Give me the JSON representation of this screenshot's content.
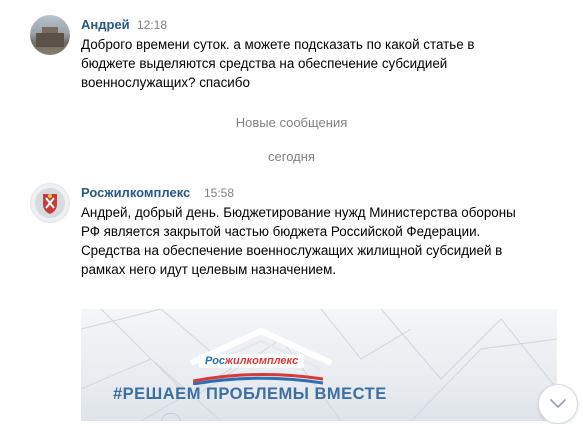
{
  "messages": [
    {
      "author": "Андрей",
      "time": "12:18",
      "text": "Доброго времени суток. а можете подсказать по какой статье в бюджете выделяются средства на обеспечение субсидией военнослужащих? спасибо"
    },
    {
      "author": "Росжилкомплекс",
      "time": "15:58",
      "text": "Андрей, добрый день. Бюджетирование нужд Министерства обороны РФ является закрытой частью бюджета Российской Федерации. Средства на обеспечение военнослужащих жилищной субсидией в рамках него идут целевым назначением."
    }
  ],
  "separators": {
    "new_messages": "Новые сообщения",
    "today": "сегодня"
  },
  "attachment": {
    "logo_part1": "Рос",
    "logo_part2": "жилкомплекс",
    "slogan": "#РЕШАЕМ ПРОБЛЕМЫ ВМЕСТЕ"
  },
  "icons": {
    "scroll_down": "chevron-down-icon"
  },
  "colors": {
    "author": "#2a5885",
    "meta": "#828282",
    "slogan": "#3d6fa3",
    "logo_red": "#d83a3a",
    "logo_blue": "#2d6fb0"
  }
}
